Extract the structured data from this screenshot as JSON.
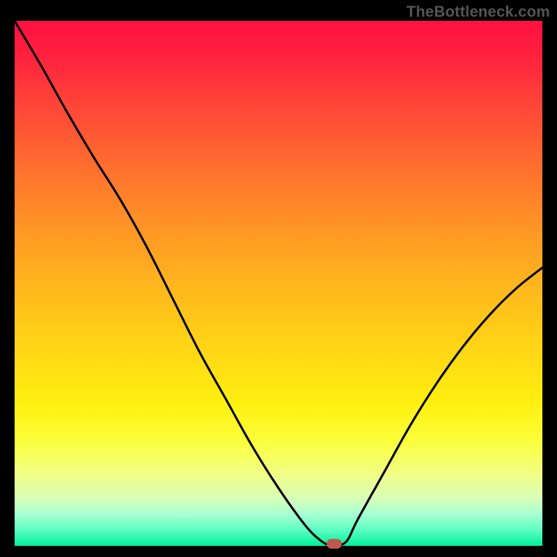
{
  "attribution": "TheBottleneck.com",
  "colors": {
    "gradient_top": "#ff1041",
    "gradient_bottom": "#00ee9a",
    "curve": "#000000",
    "marker": "#c1574e",
    "frame": "#000000"
  },
  "chart_data": {
    "type": "line",
    "title": "",
    "xlabel": "",
    "ylabel": "",
    "xlim": [
      0,
      100
    ],
    "ylim": [
      0,
      100
    ],
    "grid": false,
    "legend": false,
    "series": [
      {
        "name": "bottleneck-curve",
        "x": [
          0,
          5,
          10,
          15,
          20,
          25,
          30,
          35,
          40,
          45,
          50,
          55,
          58,
          60,
          61,
          63,
          65,
          70,
          75,
          80,
          85,
          90,
          95,
          100
        ],
        "values": [
          100,
          91.5,
          82.5,
          74,
          66,
          57,
          47,
          37,
          28,
          19,
          11,
          4,
          1,
          0,
          0,
          1,
          5,
          14,
          23,
          31,
          38,
          44,
          49,
          53
        ]
      }
    ],
    "annotations": [
      {
        "name": "minimum-marker",
        "x": 60.5,
        "y": 0
      }
    ]
  }
}
